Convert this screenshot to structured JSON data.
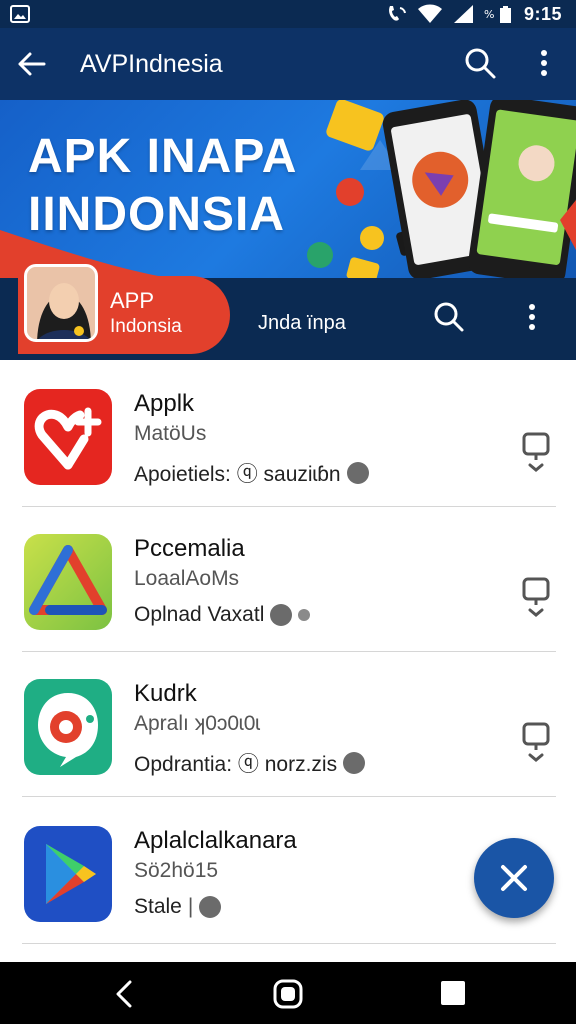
{
  "status_bar": {
    "time": "9:15"
  },
  "app_bar": {
    "title": "AVPIndnesia"
  },
  "banner": {
    "title_line1": "APK INAPA",
    "title_line2": "IINDONSIA",
    "pill_title": "APP",
    "pill_subtitle": "Indonsia",
    "strip_text": "Jnda ïnpa"
  },
  "apps": [
    {
      "name": "Applk",
      "subtitle": "MatöUs",
      "meta": "Apoietiels: ⓠ sauziɩɓn",
      "icon": "heart-app-icon"
    },
    {
      "name": "Pccemalia",
      "subtitle": "LoaalAoMs",
      "meta": "Oplnad Vaxatl",
      "icon": "triangle-app-icon"
    },
    {
      "name": "Kudrk",
      "subtitle": "Apralı ʞ0ɔ0ɩ0ɩ",
      "meta": "Opdrantia: ⓠ norz.zis",
      "icon": "chat-app-icon"
    },
    {
      "name": "Aplalclalkanara",
      "subtitle": "Sö2hö15",
      "meta": "Stale",
      "icon": "play-app-icon"
    }
  ],
  "colors": {
    "status_bar": "#0b2a52",
    "app_bar": "#0d3266",
    "banner_blue": "#1e7ae0",
    "pill_red": "#e2402c",
    "fab": "#1a55a6"
  }
}
